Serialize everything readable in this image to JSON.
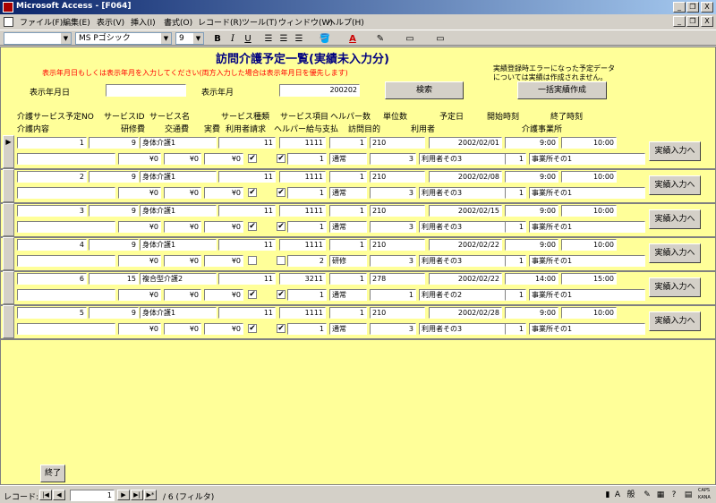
{
  "window": {
    "title": "Microsoft Access - [F064]",
    "minimize": "_",
    "restore": "❐",
    "close": "X"
  },
  "menu": [
    "ファイル(F)",
    "編集(E)",
    "表示(V)",
    "挿入(I)",
    "書式(O)",
    "レコード(R)",
    "ツール(T)",
    "ウィンドウ(W)",
    "ヘルプ(H)"
  ],
  "toolbar": {
    "font_name": "MS Pゴシック",
    "font_size": "9",
    "bold": "B",
    "italic": "I",
    "underline": "U"
  },
  "form": {
    "title": "訪問介護予定一覧(実績未入力分)",
    "instruction": "表示年月日もしくは表示年月を入力してください(両方入力した場合は表示年月日を優先します)",
    "error_note_1": "実績登録時エラーになった予定データ",
    "error_note_2": "については実績は作成されません。",
    "date_label": "表示年月日",
    "date_value": "",
    "month_label": "表示年月",
    "month_value": "200202",
    "search_button": "検索",
    "bulk_button": "一括実績作成",
    "headers_row1": [
      "介護サービス予定NO",
      "サービスID",
      "サービス名",
      "サービス種類",
      "サービス項目",
      "ヘルパー数",
      "単位数",
      "予定日",
      "開始時刻",
      "終了時刻"
    ],
    "headers_row2": [
      "介護内容",
      "研修費",
      "交通費",
      "実費",
      "利用者請求",
      "ヘルパー給与支払",
      "訪問目的",
      "利用者",
      "介護事業所"
    ],
    "row_button": "実績入力へ",
    "close_button": "終了"
  },
  "records": [
    {
      "no": "1",
      "sid": "9",
      "sname": "身体介護1",
      "stype": "11",
      "sitem": "1111",
      "helpers": "1",
      "units": "210",
      "date": "2002/02/01",
      "start": "9:00",
      "end": "10:00",
      "training": "¥0",
      "transport": "¥0",
      "actual": "¥0",
      "bill": "✔",
      "pay": "✔",
      "pcount": "1",
      "purpose": "通常",
      "uno": "3",
      "user": "利用者その3",
      "ono": "1",
      "office": "事業所その1"
    },
    {
      "no": "2",
      "sid": "9",
      "sname": "身体介護1",
      "stype": "11",
      "sitem": "1111",
      "helpers": "1",
      "units": "210",
      "date": "2002/02/08",
      "start": "9:00",
      "end": "10:00",
      "training": "¥0",
      "transport": "¥0",
      "actual": "¥0",
      "bill": "✔",
      "pay": "✔",
      "pcount": "1",
      "purpose": "通常",
      "uno": "3",
      "user": "利用者その3",
      "ono": "1",
      "office": "事業所その1"
    },
    {
      "no": "3",
      "sid": "9",
      "sname": "身体介護1",
      "stype": "11",
      "sitem": "1111",
      "helpers": "1",
      "units": "210",
      "date": "2002/02/15",
      "start": "9:00",
      "end": "10:00",
      "training": "¥0",
      "transport": "¥0",
      "actual": "¥0",
      "bill": "✔",
      "pay": "✔",
      "pcount": "1",
      "purpose": "通常",
      "uno": "3",
      "user": "利用者その3",
      "ono": "1",
      "office": "事業所その1"
    },
    {
      "no": "4",
      "sid": "9",
      "sname": "身体介護1",
      "stype": "11",
      "sitem": "1111",
      "helpers": "1",
      "units": "210",
      "date": "2002/02/22",
      "start": "9:00",
      "end": "10:00",
      "training": "¥0",
      "transport": "¥0",
      "actual": "¥0",
      "bill": "",
      "pay": "",
      "pcount": "2",
      "purpose": "研修",
      "uno": "3",
      "user": "利用者その3",
      "ono": "1",
      "office": "事業所その1"
    },
    {
      "no": "6",
      "sid": "15",
      "sname": "複合型介護2",
      "stype": "11",
      "sitem": "3211",
      "helpers": "1",
      "units": "278",
      "date": "2002/02/22",
      "start": "14:00",
      "end": "15:00",
      "training": "¥0",
      "transport": "¥0",
      "actual": "¥0",
      "bill": "✔",
      "pay": "✔",
      "pcount": "1",
      "purpose": "通常",
      "uno": "1",
      "user": "利用者その2",
      "ono": "1",
      "office": "事業所その1"
    },
    {
      "no": "5",
      "sid": "9",
      "sname": "身体介護1",
      "stype": "11",
      "sitem": "1111",
      "helpers": "1",
      "units": "210",
      "date": "2002/02/28",
      "start": "9:00",
      "end": "10:00",
      "training": "¥0",
      "transport": "¥0",
      "actual": "¥0",
      "bill": "✔",
      "pay": "✔",
      "pcount": "1",
      "purpose": "通常",
      "uno": "3",
      "user": "利用者その3",
      "ono": "1",
      "office": "事業所その1"
    }
  ],
  "status": {
    "record_label": "レコード:",
    "first": "|◀",
    "prev": "◀",
    "next": "▶",
    "last": "▶|",
    "new": "▶*",
    "current": "1",
    "total": "/ 6 (フィルタ)",
    "ime": [
      "A",
      "般"
    ],
    "caps": "CAPS",
    "kana": "KANA"
  },
  "colors": {
    "form_bg": "#ffff99",
    "title_blue": "#000080",
    "instruction_red": "#ff0000"
  }
}
